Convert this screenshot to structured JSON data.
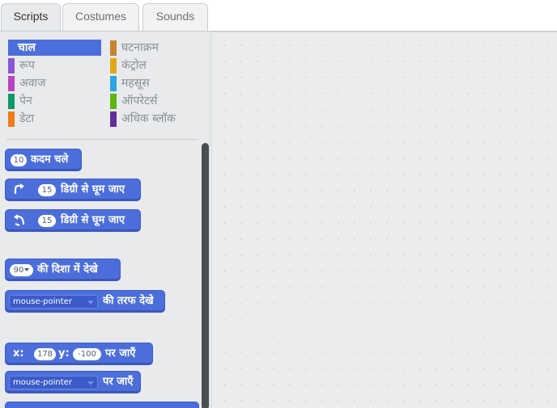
{
  "tabs": [
    {
      "label": "Scripts",
      "active": true
    },
    {
      "label": "Costumes",
      "active": false
    },
    {
      "label": "Sounds",
      "active": false
    }
  ],
  "categories": [
    {
      "label": "चाल",
      "color": "#4c6edb",
      "selected": true
    },
    {
      "label": "रूप",
      "color": "#8a55d7"
    },
    {
      "label": "अवाज",
      "color": "#bb42c3"
    },
    {
      "label": "पेन",
      "color": "#0e9a6c"
    },
    {
      "label": "डेटा",
      "color": "#ee7d16"
    },
    {
      "label": "घटनाक्रम",
      "color": "#c88330"
    },
    {
      "label": "कंट्रोल",
      "color": "#e1a91a"
    },
    {
      "label": "महसूस",
      "color": "#2ca5e2"
    },
    {
      "label": "ऑपरेटर्स",
      "color": "#5cb712"
    },
    {
      "label": "अधिक ब्लॉक",
      "color": "#632d99"
    }
  ],
  "blocks": {
    "move": {
      "steps": "10",
      "text": "कदम चले"
    },
    "turn_right": {
      "degrees": "15",
      "text": "डिग्री से घूम जाए"
    },
    "turn_left": {
      "degrees": "15",
      "text": "डिग्री से घूम जाए"
    },
    "point_direction": {
      "value": "90",
      "text": "की दिशा में देखे"
    },
    "point_towards": {
      "target": "mouse-pointer",
      "text": "की तरफ देखे"
    },
    "goto_xy": {
      "x_label": "x:",
      "x": "178",
      "y_label": "y:",
      "y": "-100",
      "text": "पर जाएँ"
    },
    "goto": {
      "target": "mouse-pointer",
      "text": "पर जाएँ"
    }
  }
}
